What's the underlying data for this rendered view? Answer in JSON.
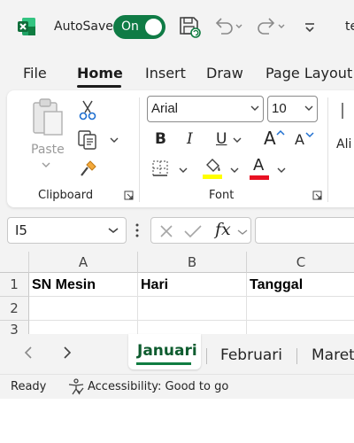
{
  "titlebar": {
    "autosave_label": "AutoSave",
    "autosave_state": "On",
    "truncated_title": "te",
    "icons": [
      "excel-logo-icon",
      "save-icon",
      "undo-icon",
      "redo-icon",
      "customize-toolbar-icon"
    ],
    "accent": "#107c41"
  },
  "ribbon_tabs": [
    "File",
    "Home",
    "Insert",
    "Draw",
    "Page Layout"
  ],
  "active_tab": "Home",
  "clipboard": {
    "paste_label": "Paste",
    "group_label": "Clipboard"
  },
  "font": {
    "name": "Arial",
    "size": "10",
    "group_label": "Font",
    "bold": "B",
    "italic": "I",
    "underline": "U",
    "grow": "A",
    "shrink": "A",
    "font_color_letter": "A",
    "highlight_color": "#ffff00",
    "font_color": "#e81123"
  },
  "alignment_partial": "Ali",
  "formula_bar": {
    "name_box": "I5",
    "fx": "fx",
    "formula": ""
  },
  "grid": {
    "columns": [
      "A",
      "B",
      "C"
    ],
    "rows": [
      {
        "num": "1",
        "cells": [
          "SN Mesin",
          "Hari",
          "Tanggal"
        ]
      },
      {
        "num": "2",
        "cells": [
          "",
          "",
          ""
        ]
      },
      {
        "num": "3",
        "cells": [
          "",
          "",
          ""
        ]
      }
    ]
  },
  "sheets": {
    "active": "Januari",
    "others": [
      "Februari",
      "Maret"
    ]
  },
  "status": {
    "ready": "Ready",
    "accessibility": "Accessibility: Good to go"
  }
}
